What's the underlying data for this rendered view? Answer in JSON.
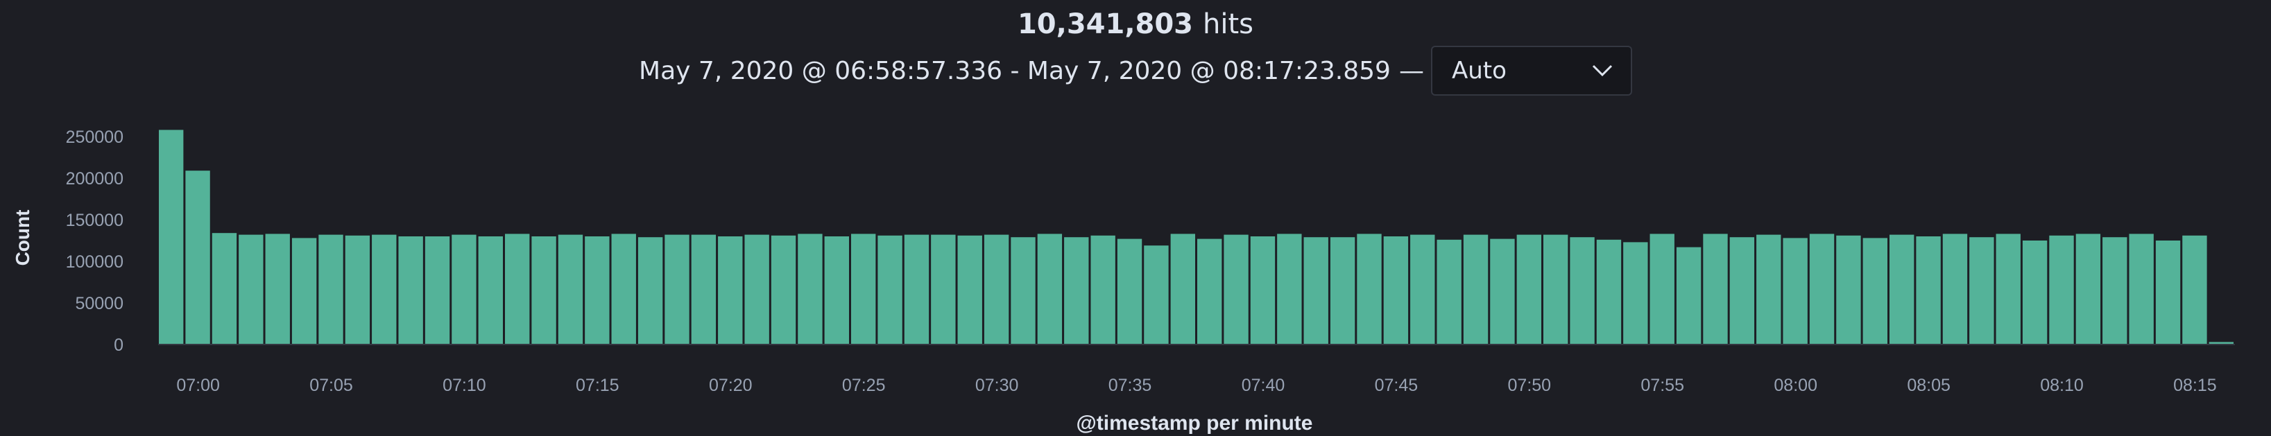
{
  "header": {
    "hit_count": "10,341,803",
    "hits_label": "hits",
    "time_range": "May 7, 2020 @ 06:58:57.336 - May 7, 2020 @ 08:17:23.859",
    "separator": "—",
    "interval": {
      "selected": "Auto",
      "icon": "chevron-down-icon"
    }
  },
  "colors": {
    "background": "#1d1e24",
    "bar": "#54b399",
    "text": "#dfe5ef",
    "tick": "#98a2b3"
  },
  "chart_data": {
    "type": "bar",
    "xlabel": "@timestamp per minute",
    "ylabel": "Count",
    "ylim": [
      0,
      275000
    ],
    "y_ticks": [
      0,
      50000,
      100000,
      150000,
      200000,
      250000
    ],
    "x_tick_labels": [
      "07:00",
      "07:05",
      "07:10",
      "07:15",
      "07:20",
      "07:25",
      "07:30",
      "07:35",
      "07:40",
      "07:45",
      "07:50",
      "07:55",
      "08:00",
      "08:05",
      "08:10",
      "08:15"
    ],
    "x_tick_start_index": 1,
    "x_tick_step": 5,
    "grid": false,
    "categories": [
      "06:58",
      "06:59",
      "07:00",
      "07:01",
      "07:02",
      "07:03",
      "07:04",
      "07:05",
      "07:06",
      "07:07",
      "07:08",
      "07:09",
      "07:10",
      "07:11",
      "07:12",
      "07:13",
      "07:14",
      "07:15",
      "07:16",
      "07:17",
      "07:18",
      "07:19",
      "07:20",
      "07:21",
      "07:22",
      "07:23",
      "07:24",
      "07:25",
      "07:26",
      "07:27",
      "07:28",
      "07:29",
      "07:30",
      "07:31",
      "07:32",
      "07:33",
      "07:34",
      "07:35",
      "07:36",
      "07:37",
      "07:38",
      "07:39",
      "07:40",
      "07:41",
      "07:42",
      "07:43",
      "07:44",
      "07:45",
      "07:46",
      "07:47",
      "07:48",
      "07:49",
      "07:50",
      "07:51",
      "07:52",
      "07:53",
      "07:54",
      "07:55",
      "07:56",
      "07:57",
      "07:58",
      "07:59",
      "08:00",
      "08:01",
      "08:02",
      "08:03",
      "08:04",
      "08:05",
      "08:06",
      "08:07",
      "08:08",
      "08:09",
      "08:10",
      "08:11",
      "08:12",
      "08:13",
      "08:14",
      "08:15",
      "08:16",
      "08:17"
    ],
    "values": [
      258000,
      209000,
      134000,
      132000,
      133000,
      128000,
      132000,
      131000,
      132000,
      130000,
      130000,
      132000,
      130000,
      133000,
      130000,
      132000,
      130000,
      133000,
      129000,
      132000,
      132000,
      130000,
      132000,
      131000,
      133000,
      130000,
      133000,
      131000,
      132000,
      132000,
      131000,
      132000,
      129000,
      133000,
      129000,
      131000,
      127000,
      119000,
      133000,
      127000,
      132000,
      130000,
      133000,
      129000,
      129000,
      133000,
      130000,
      132000,
      126000,
      132000,
      127000,
      132000,
      132000,
      129000,
      126000,
      123000,
      133000,
      117000,
      133000,
      129000,
      132000,
      128000,
      133000,
      131000,
      128000,
      132000,
      130000,
      133000,
      129000,
      133000,
      125000,
      131000,
      133000,
      129000,
      133000,
      125000,
      131000,
      3000
    ]
  }
}
